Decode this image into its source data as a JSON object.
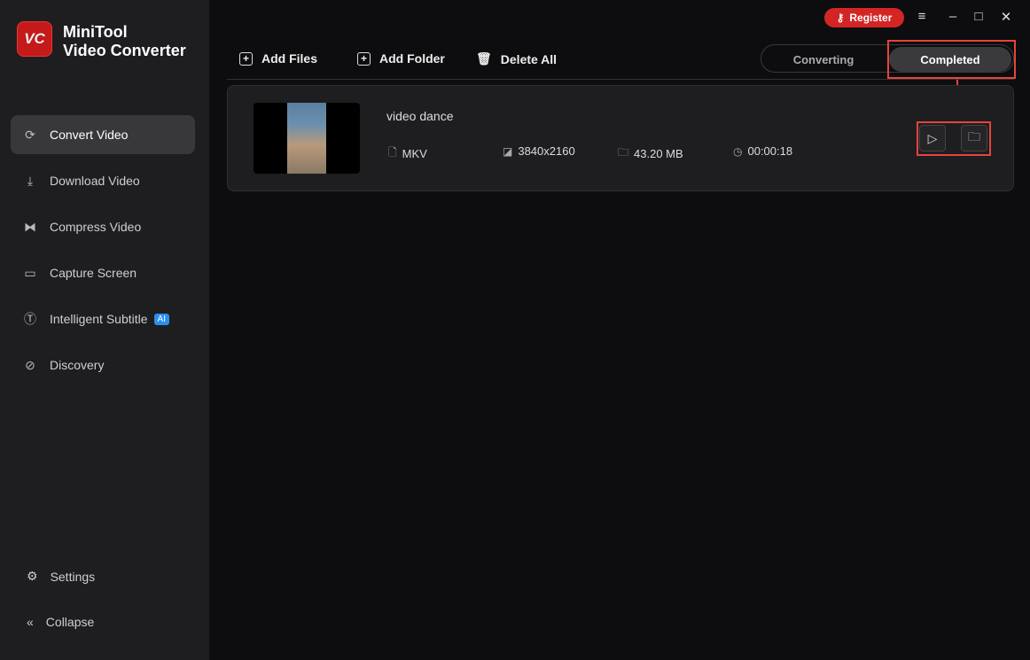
{
  "app": {
    "logo_text": "VC",
    "name_line1": "MiniTool",
    "name_line2": "Video Converter"
  },
  "sidebar": {
    "items": [
      {
        "label": "Convert Video",
        "icon": "convert-icon"
      },
      {
        "label": "Download Video",
        "icon": "download-icon"
      },
      {
        "label": "Compress Video",
        "icon": "compress-icon"
      },
      {
        "label": "Capture Screen",
        "icon": "camera-icon"
      },
      {
        "label": "Intelligent Subtitle",
        "icon": "subtitle-icon",
        "badge": "AI"
      },
      {
        "label": "Discovery",
        "icon": "compass-icon"
      }
    ],
    "settings": "Settings",
    "collapse": "Collapse"
  },
  "header": {
    "register": "Register"
  },
  "toolbar": {
    "add_files": "Add Files",
    "add_folder": "Add Folder",
    "delete_all": "Delete All"
  },
  "tabs": {
    "converting": "Converting",
    "completed": "Completed"
  },
  "file": {
    "name": "video dance",
    "format": "MKV",
    "resolution": "3840x2160",
    "size": "43.20 MB",
    "duration": "00:00:18"
  },
  "colors": {
    "accent": "#d42525",
    "highlight": "#e5443b"
  }
}
